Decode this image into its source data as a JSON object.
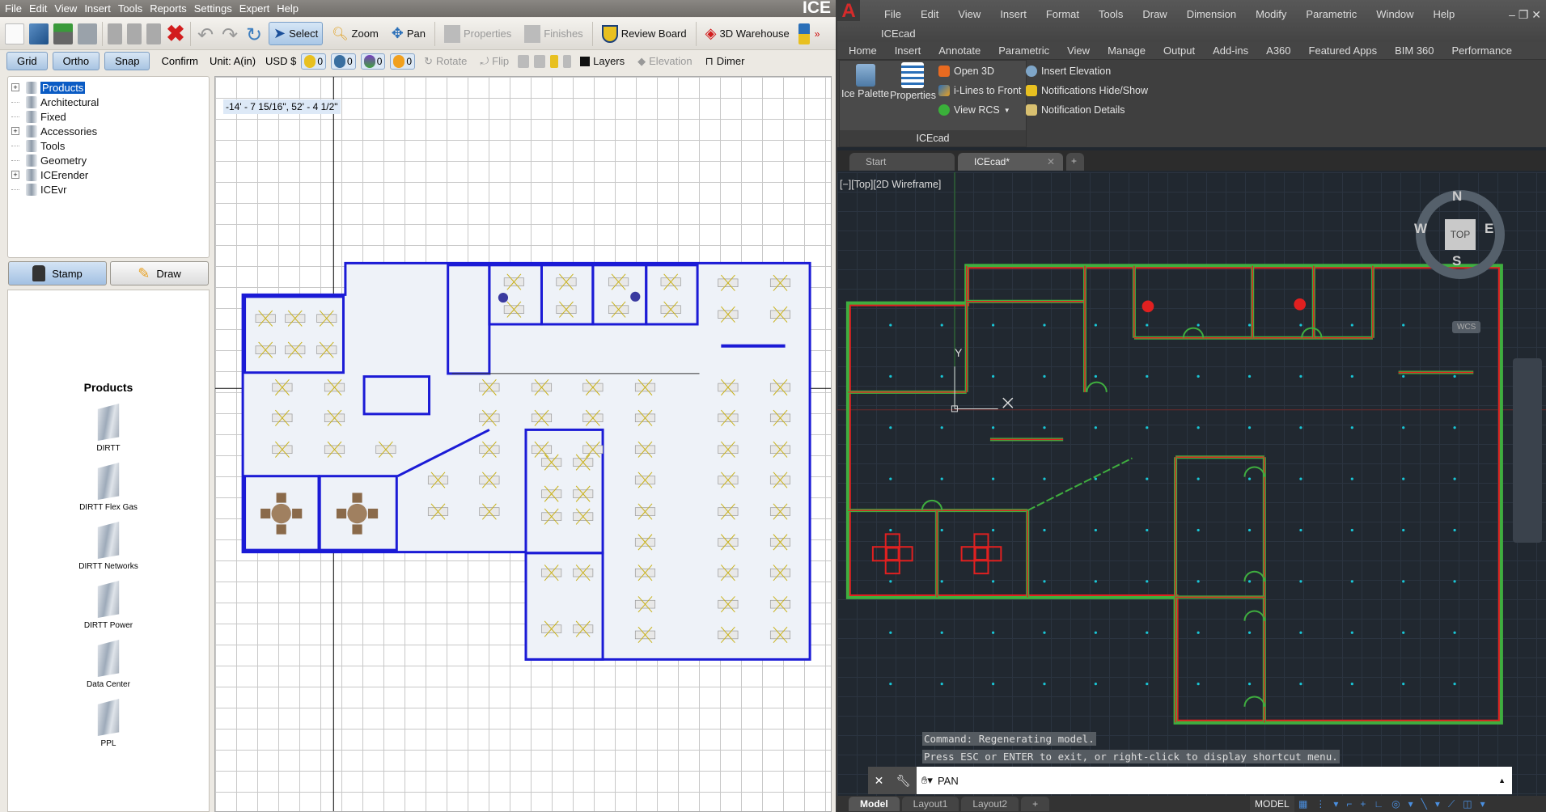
{
  "ice": {
    "menu": [
      "File",
      "Edit",
      "View",
      "Insert",
      "Tools",
      "Reports",
      "Settings",
      "Expert",
      "Help"
    ],
    "logo": "ICE",
    "toolbar1": {
      "select": "Select",
      "zoom": "Zoom",
      "pan": "Pan",
      "properties": "Properties",
      "finishes": "Finishes",
      "review_board": "Review Board",
      "warehouse": "3D Warehouse"
    },
    "toolbar2": {
      "grid": "Grid",
      "ortho": "Ortho",
      "snap": "Snap",
      "confirm": "Confirm",
      "unit": "Unit: A(in)",
      "currency": "USD $",
      "counts": [
        "0",
        "0",
        "0",
        "0"
      ],
      "rotate": "Rotate",
      "flip": "Flip",
      "layers": "Layers",
      "elevation": "Elevation",
      "dimension": "Dimer"
    },
    "tree": [
      {
        "label": "Products",
        "expandable": true,
        "selected": true
      },
      {
        "label": "Architectural"
      },
      {
        "label": "Fixed"
      },
      {
        "label": "Accessories",
        "expandable": true
      },
      {
        "label": "Tools"
      },
      {
        "label": "Geometry"
      },
      {
        "label": "ICErender",
        "expandable": true
      },
      {
        "label": "ICEvr"
      }
    ],
    "modes": {
      "stamp": "Stamp",
      "draw": "Draw"
    },
    "products": {
      "title": "Products",
      "items": [
        "DIRTT",
        "DIRTT Flex Gas",
        "DIRTT Networks",
        "DIRTT Power",
        "Data Center",
        "PPL"
      ]
    },
    "cursor_coord": "-14' - 7 15/16\", 52' - 4 1/2\""
  },
  "acad": {
    "menu": [
      "File",
      "Edit",
      "View",
      "Insert",
      "Format",
      "Tools",
      "Draw",
      "Dimension",
      "Modify",
      "Parametric",
      "Window",
      "Help"
    ],
    "menu_sub": "ICEcad",
    "ribbon_tabs": [
      "Home",
      "Insert",
      "Annotate",
      "Parametric",
      "View",
      "Manage",
      "Output",
      "Add-ins",
      "A360",
      "Featured Apps",
      "BIM 360",
      "Performance"
    ],
    "panel": {
      "title": "ICEcad",
      "ice_palette": "Ice Palette",
      "properties": "Properties",
      "open3d": "Open 3D",
      "ilines": "i-Lines to Front",
      "view_rcs": "View RCS",
      "insert_elevation": "Insert Elevation",
      "notif_toggle": "Notifications Hide/Show",
      "notif_details": "Notification Details"
    },
    "doc_tabs": [
      "Start",
      "ICEcad*"
    ],
    "viewport_label": "[−][Top][2D Wireframe]",
    "viewcube": {
      "n": "N",
      "s": "S",
      "e": "E",
      "w": "W",
      "top": "TOP",
      "wcs": "WCS"
    },
    "ucs_y": "Y",
    "command_history": [
      "Command: Regenerating model.",
      "Press ESC or ENTER to exit, or right-click to display shortcut menu."
    ],
    "command_input": "PAN",
    "layout_tabs": [
      "Model",
      "Layout1",
      "Layout2"
    ],
    "status_model": "MODEL"
  },
  "colors": {
    "ice_wall": "#1b1bd6",
    "acad_wall_red": "#e02020",
    "acad_wall_green": "#3fae3f",
    "acad_dots": "#19c6d6",
    "acad_bg": "#212830"
  }
}
